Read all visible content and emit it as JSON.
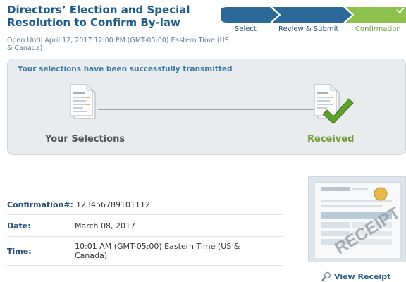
{
  "header": {
    "title": "Directors’ Election and Special Resolution to Confirm By-law",
    "subtitle": "Open Until April 12, 2017 12:00 PM (GMT-05:00) Eastern Time (US & Canada)"
  },
  "steps": [
    {
      "label": "Select",
      "state": "complete"
    },
    {
      "label": "Review & Submit",
      "state": "complete"
    },
    {
      "label": "Confirmation",
      "state": "current"
    }
  ],
  "status_panel": {
    "message": "Your selections have been successfully transmitted",
    "from_label": "Your Selections",
    "to_label": "Received"
  },
  "confirmation": {
    "number_label": "Confirmation#:",
    "number_value": "123456789101112",
    "date_label": "Date:",
    "date_value": "March 08, 2017",
    "time_label": "Time:",
    "time_value": "10:01 AM (GMT-05:00) Eastern Time (US & Canada)"
  },
  "receipt": {
    "stamp_text": "RECEIPT",
    "view_label": "View Receipt",
    "icon": "magnifier-icon"
  },
  "colors": {
    "brand_blue": "#1f5a8a",
    "step_blue": "#2b6a98",
    "success_green": "#7ab648"
  }
}
